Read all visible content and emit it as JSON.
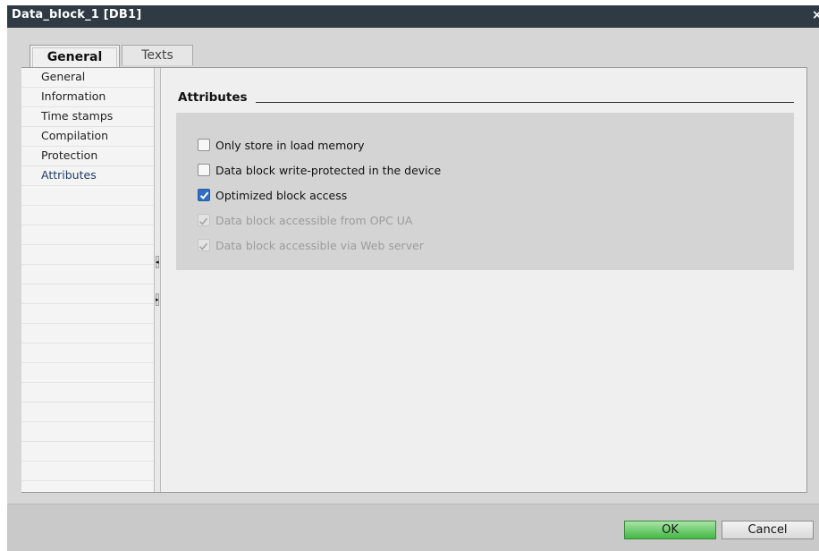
{
  "window": {
    "title": "Data_block_1 [DB1]",
    "close_glyph": "×"
  },
  "tabs": [
    {
      "label": "General",
      "active": true
    },
    {
      "label": "Texts",
      "active": false
    }
  ],
  "nav": {
    "items": [
      {
        "label": "General",
        "selected": false
      },
      {
        "label": "Information",
        "selected": false
      },
      {
        "label": "Time stamps",
        "selected": false
      },
      {
        "label": "Compilation",
        "selected": false
      },
      {
        "label": "Protection",
        "selected": false
      },
      {
        "label": "Attributes",
        "selected": true
      }
    ]
  },
  "section": {
    "title": "Attributes"
  },
  "options": [
    {
      "label": "Only store in load memory",
      "checked": false,
      "enabled": true
    },
    {
      "label": "Data block write-protected in the device",
      "checked": false,
      "enabled": true
    },
    {
      "label": "Optimized block access",
      "checked": true,
      "enabled": true
    },
    {
      "label": "Data block accessible from OPC UA",
      "checked": true,
      "enabled": false
    },
    {
      "label": "Data block accessible via Web server",
      "checked": true,
      "enabled": false
    }
  ],
  "buttons": {
    "ok_label": "OK",
    "cancel_label": "Cancel"
  },
  "colors": {
    "titlebar": "#2f3a44",
    "ok_button": "#43b843",
    "checkbox_checked": "#2d6fc6"
  }
}
